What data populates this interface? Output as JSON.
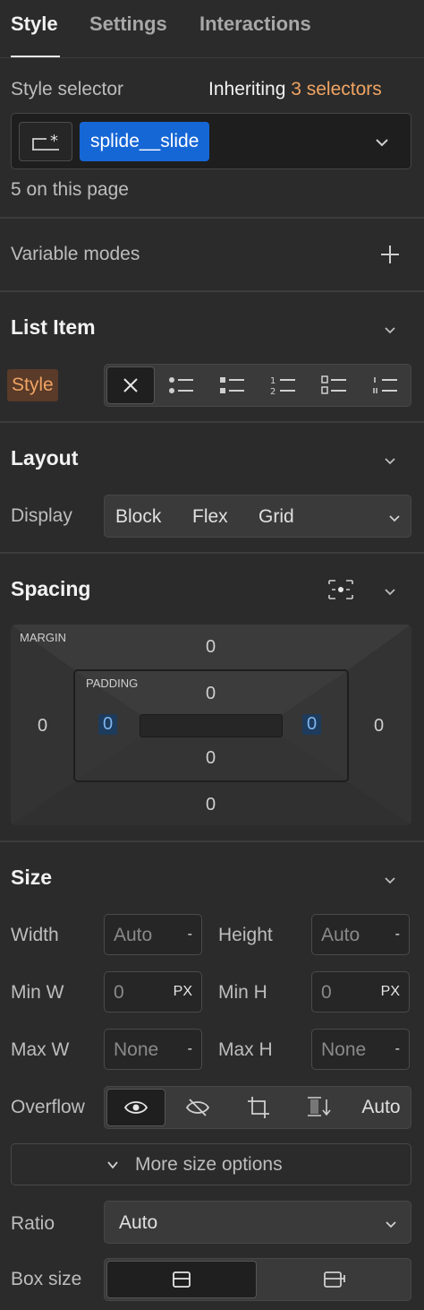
{
  "tabs": [
    {
      "label": "Style",
      "active": true
    },
    {
      "label": "Settings",
      "active": false
    },
    {
      "label": "Interactions",
      "active": false
    }
  ],
  "style_selector": {
    "label": "Style selector",
    "inheriting_label": "Inheriting",
    "inheriting_count": "3 selectors",
    "class_chip": "splide__slide",
    "on_page": "5 on this page"
  },
  "variable_modes": {
    "label": "Variable modes"
  },
  "list_item": {
    "heading": "List Item",
    "style_label": "Style",
    "options": [
      "none-icon",
      "bullets-icon",
      "squares-icon",
      "numbered-icon",
      "alpha-list-icon",
      "roman-list-icon"
    ],
    "selected": "none-icon"
  },
  "layout": {
    "heading": "Layout",
    "display_label": "Display",
    "display_options": [
      "Block",
      "Flex",
      "Grid"
    ]
  },
  "spacing": {
    "heading": "Spacing",
    "margin_label": "MARGIN",
    "padding_label": "PADDING",
    "margin": {
      "top": "0",
      "right": "0",
      "bottom": "0",
      "left": "0"
    },
    "padding": {
      "top": "0",
      "right": "0",
      "bottom": "0",
      "left": "0"
    }
  },
  "size": {
    "heading": "Size",
    "width_label": "Width",
    "width_value": "Auto",
    "width_unit": "-",
    "height_label": "Height",
    "height_value": "Auto",
    "height_unit": "-",
    "min_w_label": "Min W",
    "min_w_value": "0",
    "min_w_unit": "PX",
    "min_h_label": "Min H",
    "min_h_value": "0",
    "min_h_unit": "PX",
    "max_w_label": "Max W",
    "max_w_value": "None",
    "max_w_unit": "-",
    "max_h_label": "Max H",
    "max_h_value": "None",
    "max_h_unit": "-",
    "overflow_label": "Overflow",
    "overflow_auto": "Auto",
    "more_options": "More size options",
    "ratio_label": "Ratio",
    "ratio_value": "Auto",
    "box_size_label": "Box size"
  },
  "colors": {
    "accent_orange": "#f0a463",
    "chip_blue": "#1667d6",
    "panel_bg": "#2b2b2b"
  }
}
